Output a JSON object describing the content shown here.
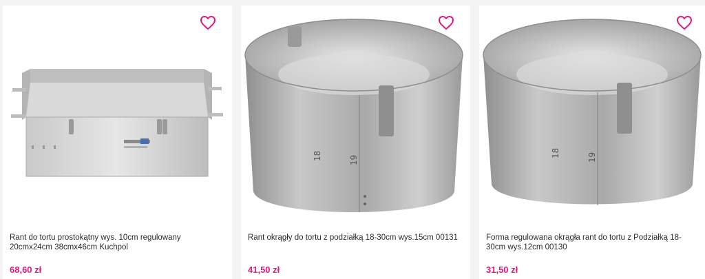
{
  "theme": {
    "accent": "#e2197d",
    "text": "#2b2b2b",
    "background": "#f4f4f4"
  },
  "products": [
    {
      "image_alt": "rectangular cake ring",
      "favorite_icon": "heart-icon",
      "title": "Rant do tortu prostokątny wys. 10cm regulowany 20cmx24cm 38cmx46cm Kuchpol",
      "price": "68,60 zł"
    },
    {
      "image_alt": "round cake ring",
      "favorite_icon": "heart-icon",
      "title": "Rant okrągły do tortu z podziałką 18-30cm wys.15cm 00131",
      "price": "41,50 zł"
    },
    {
      "image_alt": "round cake ring",
      "favorite_icon": "heart-icon",
      "title": "Forma regulowana okrągła rant do tortu z Podziałką 18-30cm wys.12cm 00130",
      "price": "31,50 zł"
    }
  ]
}
